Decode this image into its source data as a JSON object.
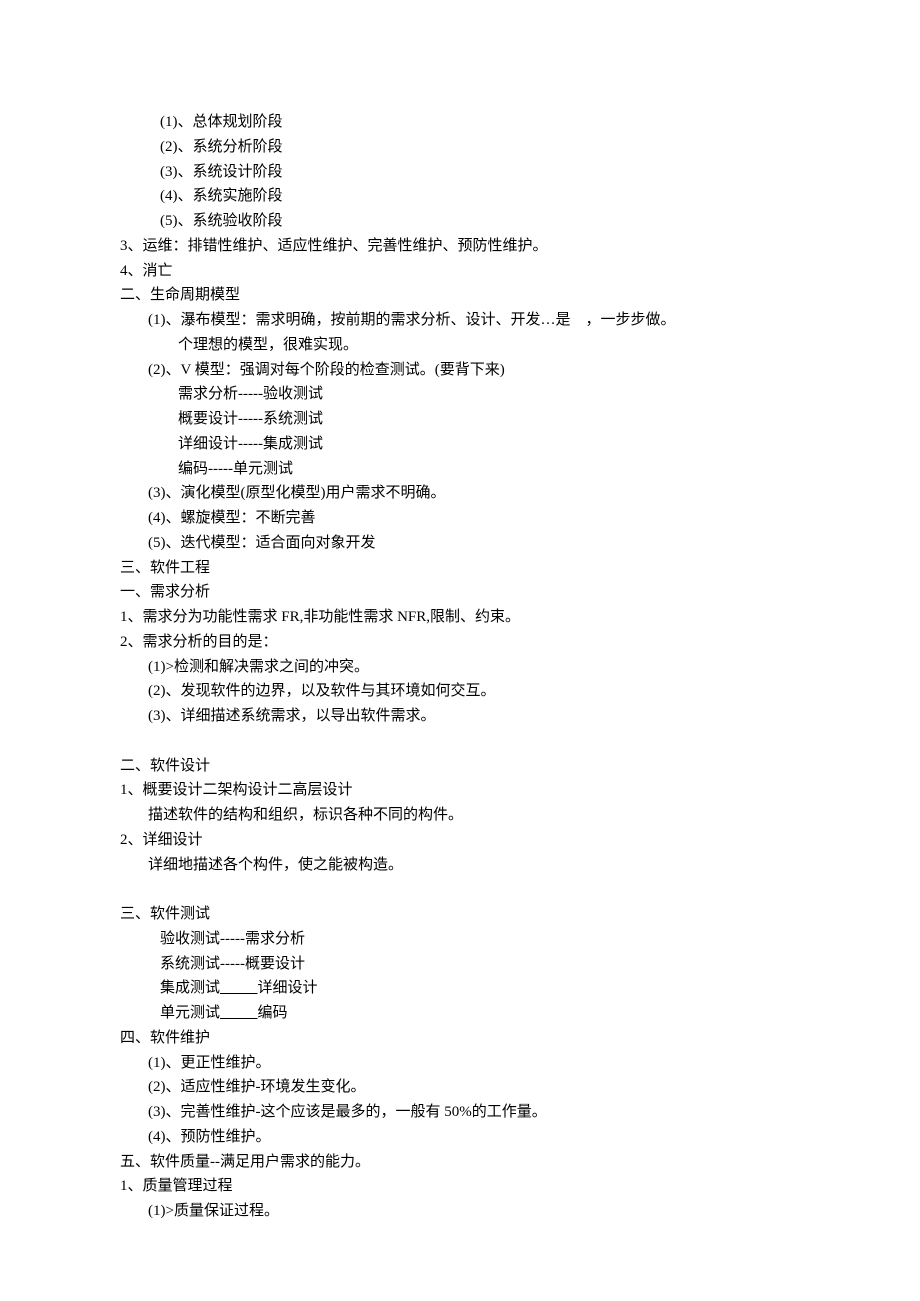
{
  "lines": [
    {
      "cls": "i2",
      "text": "(1)、总体规划阶段"
    },
    {
      "cls": "i2",
      "text": "(2)、系统分析阶段"
    },
    {
      "cls": "i2",
      "text": "(3)、系统设计阶段"
    },
    {
      "cls": "i2",
      "text": "(4)、系统实施阶段"
    },
    {
      "cls": "i2",
      "text": "(5)、系统验收阶段"
    },
    {
      "cls": "i0",
      "text": "3、运维：排错性维护、适应性维护、完善性维护、预防性维护。"
    },
    {
      "cls": "i0",
      "text": "4、消亡"
    },
    {
      "cls": "i0",
      "text": "二、生命周期模型"
    },
    {
      "cls": "i1",
      "text": "(1)、瀑布模型：需求明确，按前期的需求分析、设计、开发…是    ，一步步做。"
    },
    {
      "cls": "i3",
      "text": "个理想的模型，很难实现。"
    },
    {
      "cls": "i1",
      "text": "(2)、V 模型：强调对每个阶段的检查测试。(要背下来)"
    },
    {
      "cls": "i3",
      "text": "需求分析-----验收测试"
    },
    {
      "cls": "i3",
      "text": "概要设计-----系统测试"
    },
    {
      "cls": "i3",
      "text": "详细设计-----集成测试"
    },
    {
      "cls": "i3",
      "text": "编码-----单元测试"
    },
    {
      "cls": "i1",
      "text": "(3)、演化模型(原型化模型)用户需求不明确。"
    },
    {
      "cls": "i1",
      "text": "(4)、螺旋模型：不断完善"
    },
    {
      "cls": "i1",
      "text": "(5)、迭代模型：适合面向对象开发"
    },
    {
      "cls": "i0",
      "text": "三、软件工程"
    },
    {
      "cls": "i0",
      "text": "一、需求分析"
    },
    {
      "cls": "i0",
      "text": "1、需求分为功能性需求 FR,非功能性需求 NFR,限制、约束。"
    },
    {
      "cls": "i0",
      "text": "2、需求分析的目的是："
    },
    {
      "cls": "i1",
      "text": "(1)>检测和解决需求之间的冲突。"
    },
    {
      "cls": "i1",
      "text": "(2)、发现软件的边界，以及软件与其环境如何交互。"
    },
    {
      "cls": "i1",
      "text": "(3)、详细描述系统需求，以导出软件需求。"
    },
    {
      "cls": "i0",
      "text": " "
    },
    {
      "cls": "i0",
      "text": "二、软件设计"
    },
    {
      "cls": "i0",
      "text": "1、概要设计二架构设计二高层设计"
    },
    {
      "cls": "i1",
      "text": "描述软件的结构和组织，标识各种不同的构件。"
    },
    {
      "cls": "i0",
      "text": "2、详细设计"
    },
    {
      "cls": "i1",
      "text": "详细地描述各个构件，使之能被构造。"
    },
    {
      "cls": "i0",
      "text": " "
    },
    {
      "cls": "i0",
      "text": "三、软件测试"
    },
    {
      "cls": "i2",
      "text": "验收测试-----需求分析"
    },
    {
      "cls": "i2",
      "text": "系统测试-----概要设计"
    },
    {
      "cls": "i2",
      "parts": [
        {
          "text": "集成测试"
        },
        {
          "underline": true,
          "text": "          "
        },
        {
          "text": "详细设计"
        }
      ]
    },
    {
      "cls": "i2",
      "parts": [
        {
          "text": "单元测试"
        },
        {
          "underline": true,
          "text": "          "
        },
        {
          "text": "编码"
        }
      ]
    },
    {
      "cls": "i0",
      "text": "四、软件维护"
    },
    {
      "cls": "i1",
      "text": "(1)、更正性维护。"
    },
    {
      "cls": "i1",
      "text": "(2)、适应性维护-环境发生变化。"
    },
    {
      "cls": "i1",
      "text": "(3)、完善性维护-这个应该是最多的，一般有 50%的工作量。"
    },
    {
      "cls": "i1",
      "text": "(4)、预防性维护。"
    },
    {
      "cls": "i0",
      "text": "五、软件质量--满足用户需求的能力。"
    },
    {
      "cls": "i0",
      "text": "1、质量管理过程"
    },
    {
      "cls": "i1",
      "text": "(1)>质量保证过程。"
    }
  ]
}
